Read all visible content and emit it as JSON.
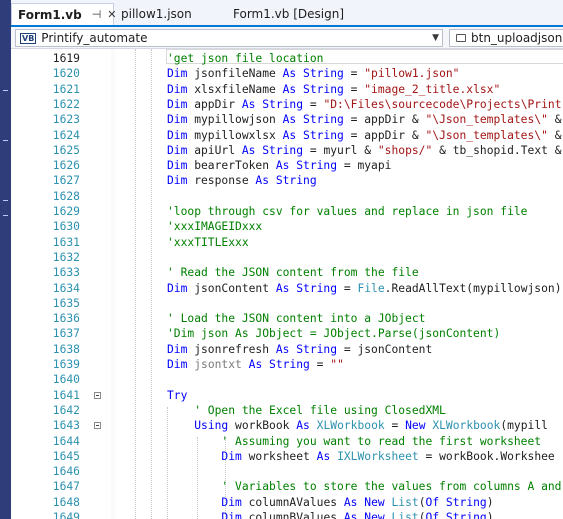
{
  "tabs": [
    {
      "label": "Form1.vb",
      "active": true,
      "pin": "⊣",
      "close": "✕"
    },
    {
      "label": "pillow1.json",
      "active": false
    },
    {
      "label": "Form1.vb [Design]",
      "active": false
    }
  ],
  "toolbar": {
    "project_badge": "VB",
    "project": "Printify_automate",
    "member": "btn_uploadjson"
  },
  "code_lines": [
    {
      "num": "1619",
      "tokens": [
        {
          "t": "'get json file location",
          "c": "cm"
        }
      ]
    },
    {
      "num": "1620",
      "tokens": [
        {
          "t": "Dim",
          "c": "kw"
        },
        {
          "t": " jsonfileName ",
          "c": "pl"
        },
        {
          "t": "As String",
          "c": "kw"
        },
        {
          "t": " = ",
          "c": "pl"
        },
        {
          "t": "\"pillow1.json\"",
          "c": "str"
        }
      ]
    },
    {
      "num": "1621",
      "tokens": [
        {
          "t": "Dim",
          "c": "kw"
        },
        {
          "t": " xlsxfileName ",
          "c": "pl"
        },
        {
          "t": "As String",
          "c": "kw"
        },
        {
          "t": " = ",
          "c": "pl"
        },
        {
          "t": "\"image_2_title.xlsx\"",
          "c": "str"
        }
      ]
    },
    {
      "num": "1622",
      "tokens": [
        {
          "t": "Dim",
          "c": "kw"
        },
        {
          "t": " appDir ",
          "c": "pl"
        },
        {
          "t": "As String",
          "c": "kw"
        },
        {
          "t": " = ",
          "c": "pl"
        },
        {
          "t": "\"D:\\Files\\sourcecode\\Projects\\Print",
          "c": "str"
        }
      ]
    },
    {
      "num": "1623",
      "tokens": [
        {
          "t": "Dim",
          "c": "kw"
        },
        {
          "t": " mypillowjson ",
          "c": "pl"
        },
        {
          "t": "As String",
          "c": "kw"
        },
        {
          "t": " = appDir & ",
          "c": "pl"
        },
        {
          "t": "\"\\Json_templates\\\"",
          "c": "str"
        },
        {
          "t": " &",
          "c": "pl"
        }
      ]
    },
    {
      "num": "1624",
      "tokens": [
        {
          "t": "Dim",
          "c": "kw"
        },
        {
          "t": " mypillowxlsx ",
          "c": "pl"
        },
        {
          "t": "As String",
          "c": "kw"
        },
        {
          "t": " = appDir & ",
          "c": "pl"
        },
        {
          "t": "\"\\Json_templates\\\"",
          "c": "str"
        },
        {
          "t": " &",
          "c": "pl"
        }
      ]
    },
    {
      "num": "1625",
      "tokens": [
        {
          "t": "Dim",
          "c": "kw"
        },
        {
          "t": " apiUrl ",
          "c": "pl"
        },
        {
          "t": "As String",
          "c": "kw"
        },
        {
          "t": " = myurl & ",
          "c": "pl"
        },
        {
          "t": "\"shops/\"",
          "c": "str"
        },
        {
          "t": " & tb_shopid.Text &",
          "c": "pl"
        }
      ]
    },
    {
      "num": "1626",
      "tokens": [
        {
          "t": "Dim",
          "c": "kw"
        },
        {
          "t": " bearerToken ",
          "c": "pl"
        },
        {
          "t": "As String",
          "c": "kw"
        },
        {
          "t": " = myapi",
          "c": "pl"
        }
      ]
    },
    {
      "num": "1627",
      "tokens": [
        {
          "t": "Dim",
          "c": "kw"
        },
        {
          "t": " response ",
          "c": "pl"
        },
        {
          "t": "As String",
          "c": "kw"
        }
      ]
    },
    {
      "num": "1628",
      "tokens": []
    },
    {
      "num": "1629",
      "tokens": [
        {
          "t": "'loop through csv for values and replace in json file",
          "c": "cm"
        }
      ]
    },
    {
      "num": "1630",
      "tokens": [
        {
          "t": "'xxxIMAGEIDxxx",
          "c": "cm"
        }
      ]
    },
    {
      "num": "1631",
      "tokens": [
        {
          "t": "'xxxTITLExxx",
          "c": "cm"
        }
      ]
    },
    {
      "num": "1632",
      "tokens": []
    },
    {
      "num": "1633",
      "tokens": [
        {
          "t": "' Read the JSON content from the file",
          "c": "cm"
        }
      ]
    },
    {
      "num": "1634",
      "tokens": [
        {
          "t": "Dim",
          "c": "kw"
        },
        {
          "t": " jsonContent ",
          "c": "pl"
        },
        {
          "t": "As String",
          "c": "kw"
        },
        {
          "t": " = ",
          "c": "pl"
        },
        {
          "t": "File",
          "c": "ty"
        },
        {
          "t": ".ReadAllText(mypillowjson)",
          "c": "pl"
        }
      ]
    },
    {
      "num": "1635",
      "tokens": []
    },
    {
      "num": "1636",
      "tokens": [
        {
          "t": "' Load the JSON content into a JObject",
          "c": "cm"
        }
      ]
    },
    {
      "num": "1637",
      "tokens": [
        {
          "t": "'Dim json As JObject = JObject.Parse(jsonContent)",
          "c": "cm"
        }
      ]
    },
    {
      "num": "1638",
      "tokens": [
        {
          "t": "Dim",
          "c": "kw"
        },
        {
          "t": " jsonrefresh ",
          "c": "pl"
        },
        {
          "t": "As String",
          "c": "kw"
        },
        {
          "t": " = jsonContent",
          "c": "pl"
        }
      ]
    },
    {
      "num": "1639",
      "tokens": [
        {
          "t": "Dim",
          "c": "kw"
        },
        {
          "t": " ",
          "c": "pl"
        },
        {
          "t": "jsontxt",
          "c": "dim"
        },
        {
          "t": " ",
          "c": "pl"
        },
        {
          "t": "As String",
          "c": "kw"
        },
        {
          "t": " = ",
          "c": "pl"
        },
        {
          "t": "\"\"",
          "c": "str"
        }
      ]
    },
    {
      "num": "1640",
      "tokens": []
    },
    {
      "num": "1641",
      "tokens": [
        {
          "t": "Try",
          "c": "kw"
        }
      ]
    },
    {
      "num": "1642",
      "tokens": [
        {
          "t": "    ' Open the Excel file using ClosedXML",
          "c": "cm"
        }
      ]
    },
    {
      "num": "1643",
      "tokens": [
        {
          "t": "    ",
          "c": "pl"
        },
        {
          "t": "Using",
          "c": "kw"
        },
        {
          "t": " workBook ",
          "c": "pl"
        },
        {
          "t": "As",
          "c": "kw"
        },
        {
          "t": " ",
          "c": "pl"
        },
        {
          "t": "XLWorkbook",
          "c": "ty"
        },
        {
          "t": " = ",
          "c": "pl"
        },
        {
          "t": "New",
          "c": "kw"
        },
        {
          "t": " ",
          "c": "pl"
        },
        {
          "t": "XLWorkbook",
          "c": "ty"
        },
        {
          "t": "(mypill",
          "c": "pl"
        }
      ]
    },
    {
      "num": "1644",
      "tokens": [
        {
          "t": "        ' Assuming you want to read the first worksheet",
          "c": "cm"
        }
      ]
    },
    {
      "num": "1645",
      "tokens": [
        {
          "t": "        ",
          "c": "pl"
        },
        {
          "t": "Dim",
          "c": "kw"
        },
        {
          "t": " worksheet ",
          "c": "pl"
        },
        {
          "t": "As",
          "c": "kw"
        },
        {
          "t": " ",
          "c": "pl"
        },
        {
          "t": "IXLWorksheet",
          "c": "ty"
        },
        {
          "t": " = workBook.Workshee",
          "c": "pl"
        }
      ]
    },
    {
      "num": "1646",
      "tokens": []
    },
    {
      "num": "1647",
      "tokens": [
        {
          "t": "        ' Variables to store the values from columns A and",
          "c": "cm"
        }
      ]
    },
    {
      "num": "1648",
      "tokens": [
        {
          "t": "        ",
          "c": "pl"
        },
        {
          "t": "Dim",
          "c": "kw"
        },
        {
          "t": " columnAValues ",
          "c": "pl"
        },
        {
          "t": "As New",
          "c": "kw"
        },
        {
          "t": " ",
          "c": "pl"
        },
        {
          "t": "List",
          "c": "ty"
        },
        {
          "t": "(",
          "c": "pl"
        },
        {
          "t": "Of String",
          "c": "kw"
        },
        {
          "t": ")",
          "c": "pl"
        }
      ]
    },
    {
      "num": "1649",
      "tokens": [
        {
          "t": "        ",
          "c": "pl"
        },
        {
          "t": "Dim",
          "c": "kw"
        },
        {
          "t": " columnBValues ",
          "c": "pl"
        },
        {
          "t": "As New",
          "c": "kw"
        },
        {
          "t": " ",
          "c": "pl"
        },
        {
          "t": "List",
          "c": "ty"
        },
        {
          "t": "(",
          "c": "pl"
        },
        {
          "t": "Of String",
          "c": "kw"
        },
        {
          "t": ")",
          "c": "pl"
        }
      ]
    }
  ],
  "colors": {
    "keyword": "#0000ff",
    "string": "#a31515",
    "comment": "#008000",
    "type": "#2b91af",
    "line_number": "#2b91af",
    "accent": "#0078d4"
  }
}
